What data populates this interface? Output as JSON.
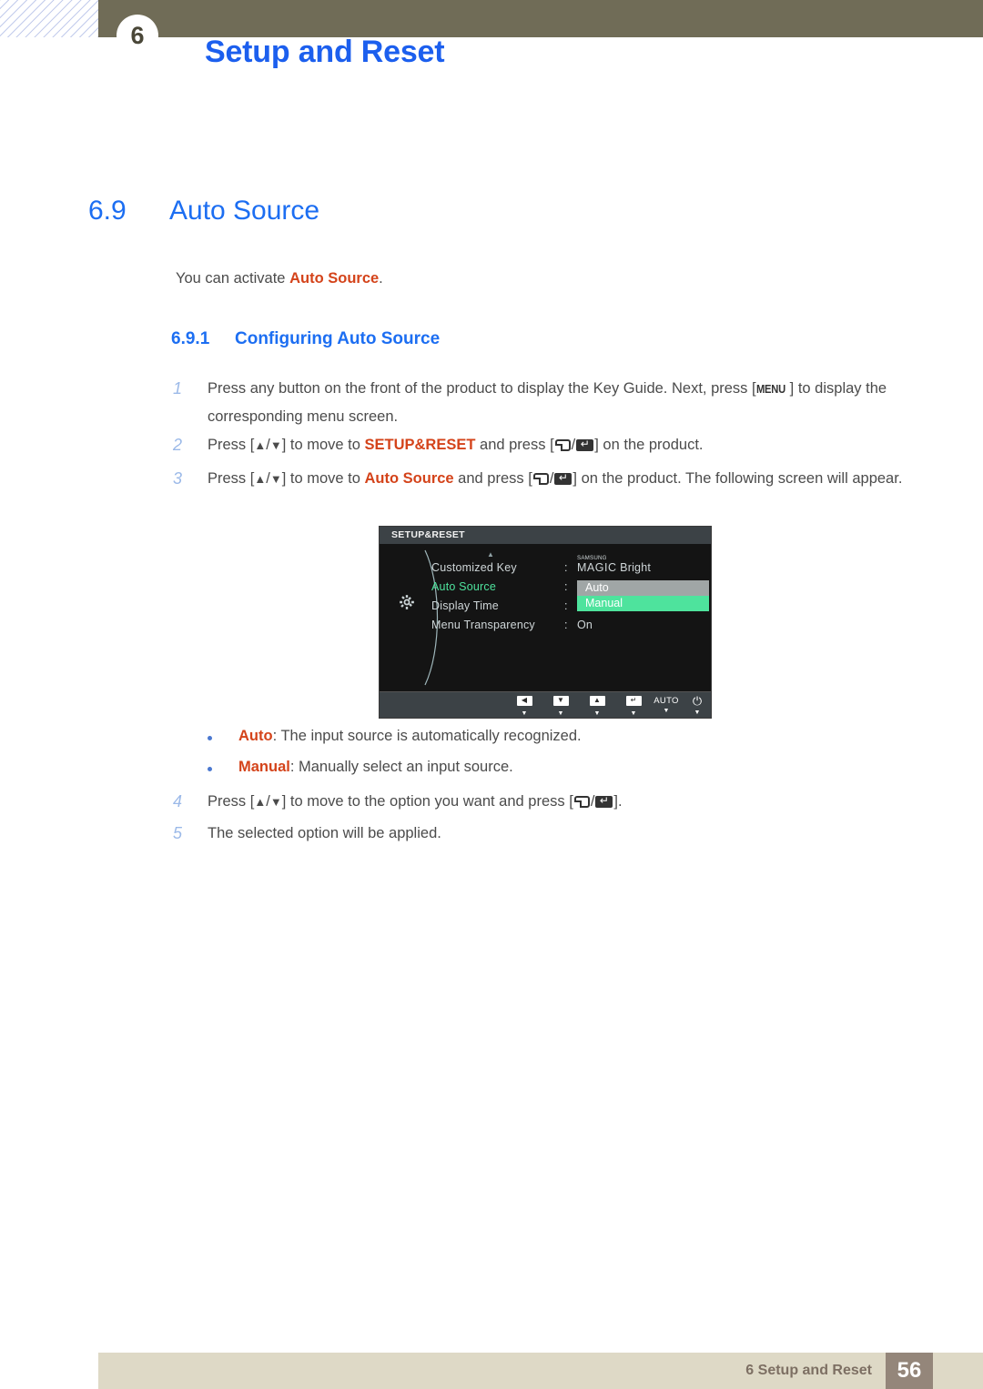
{
  "header": {
    "chapter_number": "6",
    "title": "Setup and Reset"
  },
  "section": {
    "number": "6.9",
    "title": "Auto Source"
  },
  "intro": {
    "prefix": "You can activate ",
    "highlight": "Auto Source",
    "suffix": "."
  },
  "subsection": {
    "number": "6.9.1",
    "title": "Configuring Auto Source"
  },
  "steps": [
    {
      "index": "1",
      "t1": "Press any button on the front of the product to display the Key Guide. Next, press [",
      "key": "MENU",
      "t2": "] to display the corresponding menu screen."
    },
    {
      "index": "2",
      "t1": "Press [",
      "t2": "/",
      "t3": "] to move to ",
      "hl": "SETUP&RESET",
      "t4": " and press [",
      "t5": "/",
      "t6": "] on the product."
    },
    {
      "index": "3",
      "t1": "Press [",
      "t2": "/",
      "t3": "] to move to ",
      "hl": "Auto Source",
      "t4": " and press [",
      "t5": "/",
      "t6": "] on the product. The following screen will appear."
    },
    {
      "index": "4",
      "t1": "Press [",
      "t2": "/",
      "t3": "] to move to the option you want and press [",
      "t4": "/",
      "t5": "]."
    },
    {
      "index": "5",
      "t1": "The selected option will be applied."
    }
  ],
  "bullets": [
    {
      "term": "Auto",
      "desc": ": The input source is automatically recognized."
    },
    {
      "term": "Manual",
      "desc": ": Manually select an input source."
    }
  ],
  "osd": {
    "title": "SETUP&RESET",
    "rows": [
      {
        "label": "Customized Key",
        "colon": ":",
        "value_samsung": "SAMSUNG",
        "value_magic": "MAGIC",
        "value_rest": "Bright"
      },
      {
        "label": "Auto Source",
        "colon": ":",
        "value": ""
      },
      {
        "label": "Display Time",
        "colon": ":",
        "value": ""
      },
      {
        "label": "Menu Transparency",
        "colon": ":",
        "value": "On"
      }
    ],
    "dropdown": [
      {
        "label": "Auto",
        "state": "normal"
      },
      {
        "label": "Manual",
        "state": "selected"
      }
    ],
    "keybar": [
      {
        "glyph": "◀",
        "type": "box",
        "caret": "▼"
      },
      {
        "glyph": "▼",
        "type": "box",
        "caret": "▼"
      },
      {
        "glyph": "▲",
        "type": "box",
        "caret": "▼"
      },
      {
        "glyph": "↵",
        "type": "box",
        "caret": "▼"
      },
      {
        "glyph": "AUTO",
        "type": "text",
        "caret": "▼"
      },
      {
        "glyph": "⏻",
        "type": "power",
        "caret": "▼"
      }
    ],
    "colors": {
      "background": "#141414",
      "titlebar": "#3c4246",
      "selected_text": "#4ee39d",
      "dropdown_normal": "#a0a6a6",
      "dropdown_highlight": "#4ee39d"
    }
  },
  "footer": {
    "text": "6 Setup and Reset",
    "page": "56"
  },
  "colors": {
    "header_bar": "#706c57",
    "heading_blue": "#1c6ef2",
    "accent_orange": "#d4431a",
    "footer_bar": "#ded9c6",
    "footer_page_box": "#94867a"
  }
}
